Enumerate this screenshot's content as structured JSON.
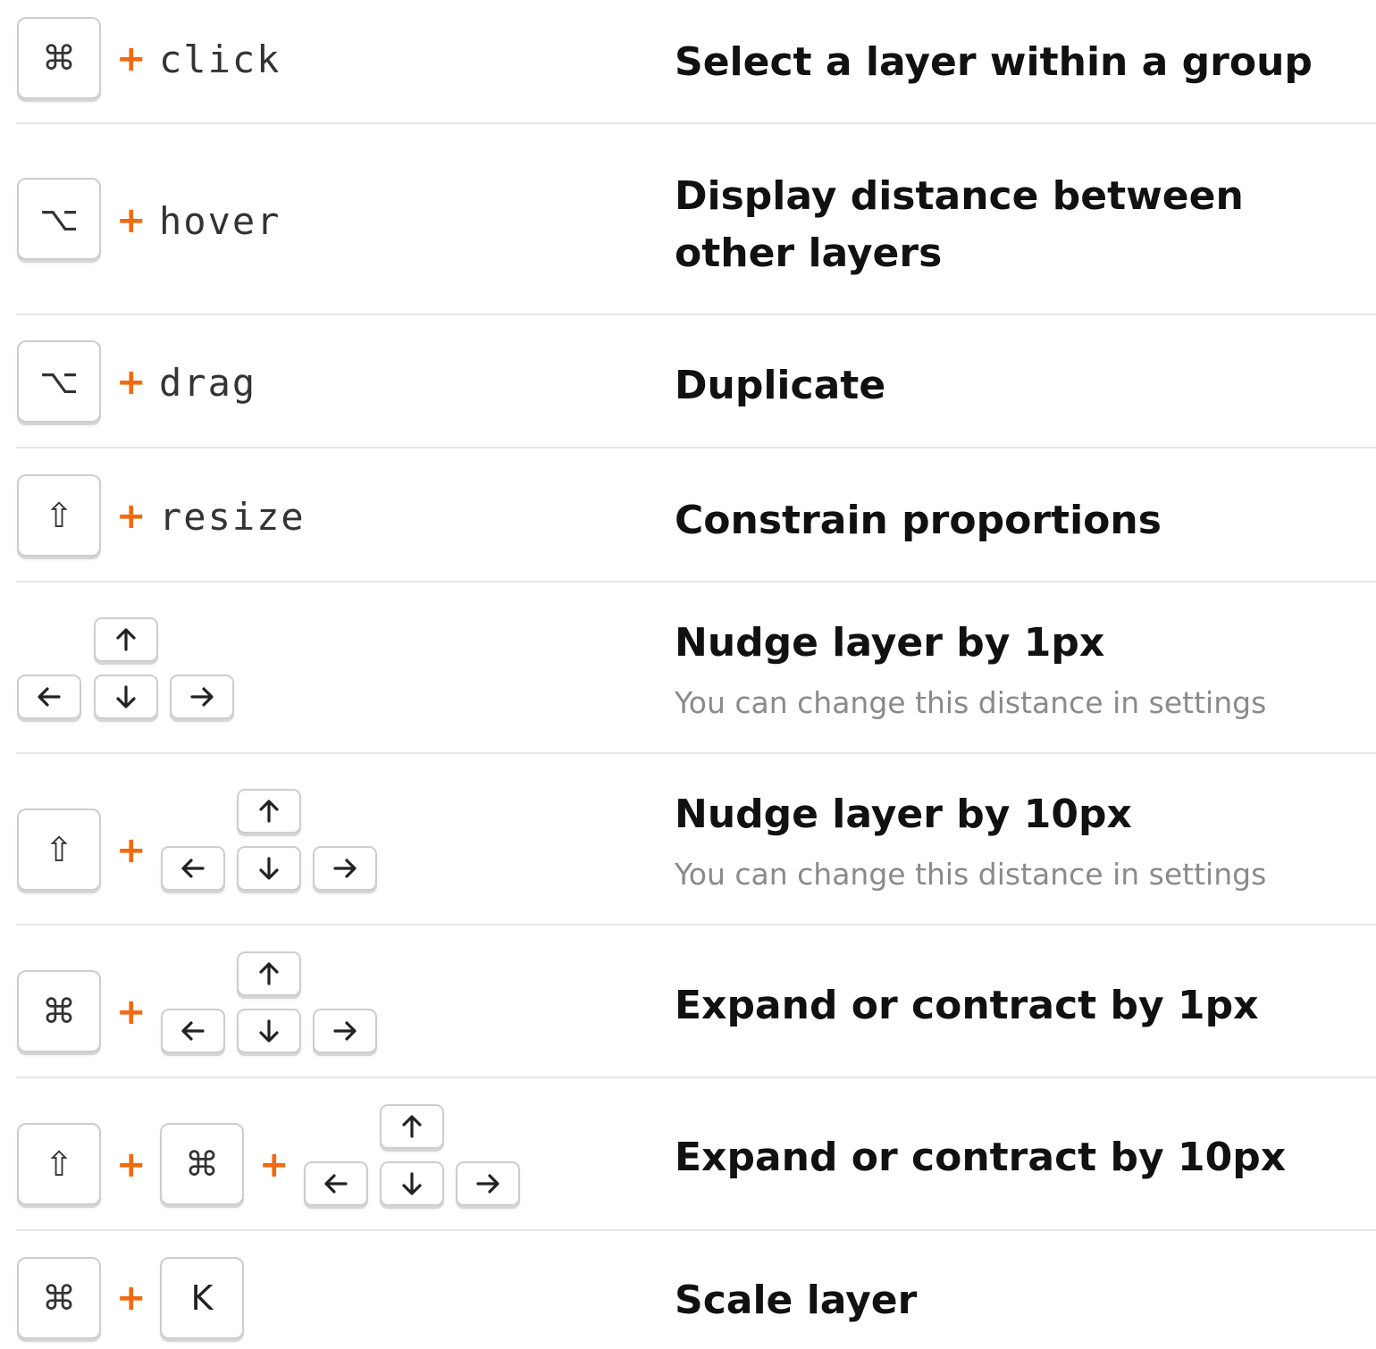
{
  "accent_color": "#f06a0f",
  "keys": {
    "cmd": "⌘",
    "option": "⌥",
    "shift": "⇧",
    "k": "K",
    "plus": "+"
  },
  "shortcuts": [
    {
      "action": "click",
      "description": "Select a layer within a group"
    },
    {
      "action": "hover",
      "description": "Display distance between other layers"
    },
    {
      "action": "drag",
      "description": "Duplicate"
    },
    {
      "action": "resize",
      "description": "Constrain proportions"
    },
    {
      "description": "Nudge layer by 1px",
      "note": "You can change this distance in settings"
    },
    {
      "description": "Nudge layer by 10px",
      "note": "You can change this distance in settings"
    },
    {
      "description": "Expand or contract by 1px"
    },
    {
      "description": "Expand or contract by 10px"
    },
    {
      "description": "Scale layer"
    }
  ]
}
